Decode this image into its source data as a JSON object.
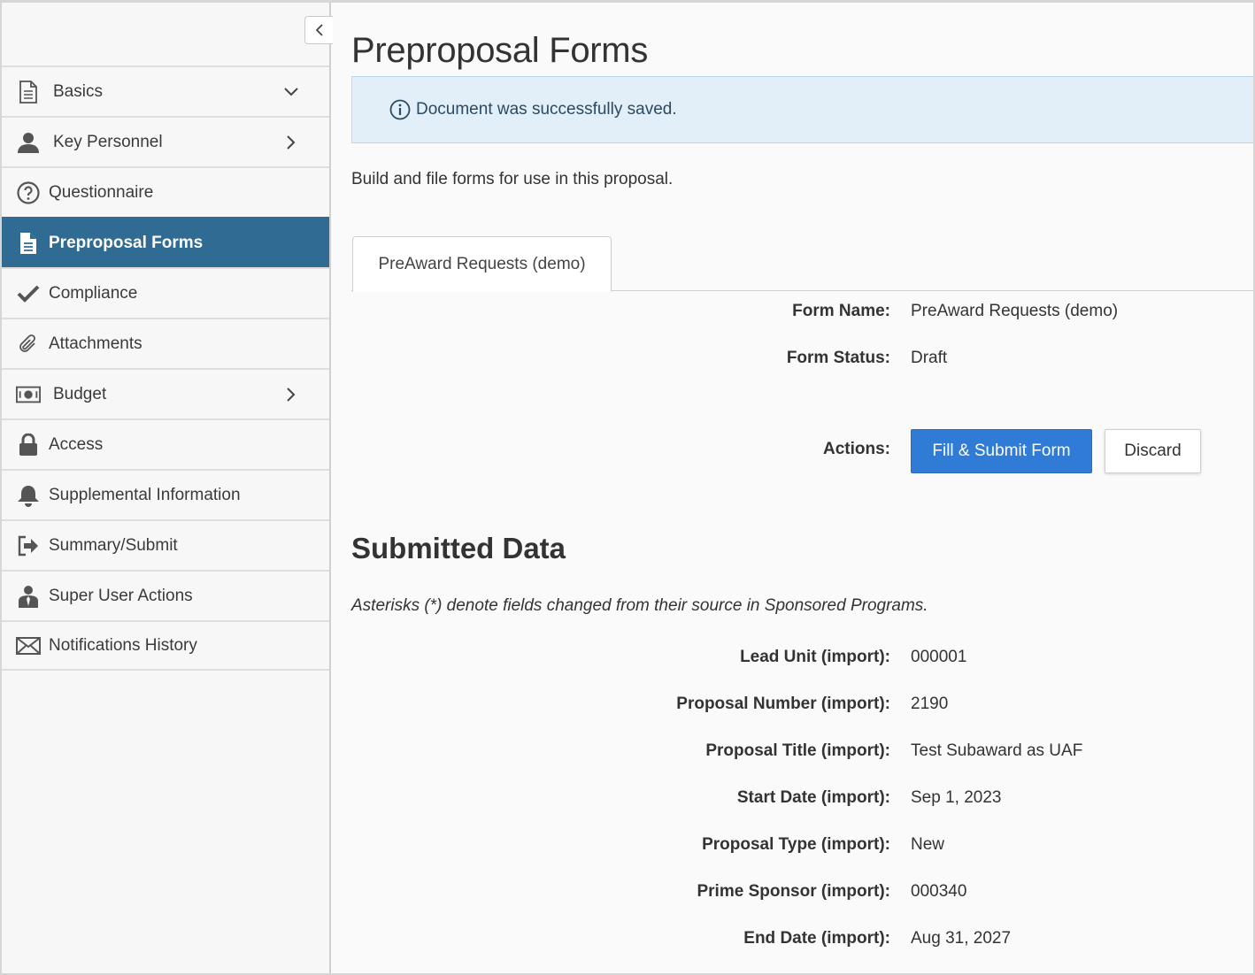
{
  "sidebar": {
    "collapse_icon": "chevron-left-icon",
    "items": [
      {
        "label": "Basics",
        "icon": "document-icon",
        "chevron": "chevron-down-icon"
      },
      {
        "label": "Key Personnel",
        "icon": "person-icon",
        "chevron": "chevron-right-icon"
      },
      {
        "label": "Questionnaire",
        "icon": "question-circle-icon"
      },
      {
        "label": "Preproposal Forms",
        "icon": "file-text-icon",
        "active": true
      },
      {
        "label": "Compliance",
        "icon": "checkmark-icon"
      },
      {
        "label": "Attachments",
        "icon": "paperclip-icon"
      },
      {
        "label": "Budget",
        "icon": "money-icon",
        "chevron": "chevron-right-icon"
      },
      {
        "label": "Access",
        "icon": "lock-icon"
      },
      {
        "label": "Supplemental Information",
        "icon": "bell-icon"
      },
      {
        "label": "Summary/Submit",
        "icon": "sign-out-icon"
      },
      {
        "label": "Super User Actions",
        "icon": "user-tie-icon"
      },
      {
        "label": "Notifications History",
        "icon": "envelope-icon"
      }
    ],
    "active_color": "#2f6b93"
  },
  "main": {
    "title": "Preproposal Forms",
    "alert": {
      "text": "Document was successfully saved.",
      "icon": "info-circle-icon"
    },
    "intro": "Build and file forms for use in this proposal.",
    "tabs": [
      {
        "label": "PreAward Requests (demo)",
        "active": true
      }
    ],
    "form": {
      "name_label": "Form Name:",
      "name_value": "PreAward Requests (demo)",
      "status_label": "Form Status:",
      "status_value": "Draft",
      "actions_label": "Actions:",
      "primary_action": "Fill & Submit Form",
      "secondary_action": "Discard"
    },
    "submitted": {
      "title": "Submitted Data",
      "note": "Asterisks (*) denote fields changed from their source in Sponsored Programs.",
      "fields": [
        {
          "label": "Lead Unit (import):",
          "value": "000001"
        },
        {
          "label": "Proposal Number (import):",
          "value": "2190"
        },
        {
          "label": "Proposal Title (import):",
          "value": "Test Subaward as UAF"
        },
        {
          "label": "Start Date (import):",
          "value": "Sep 1, 2023"
        },
        {
          "label": "Proposal Type (import):",
          "value": "New"
        },
        {
          "label": "Prime Sponsor (import):",
          "value": "000340"
        },
        {
          "label": "End Date (import):",
          "value": "Aug 31, 2027"
        }
      ]
    }
  }
}
